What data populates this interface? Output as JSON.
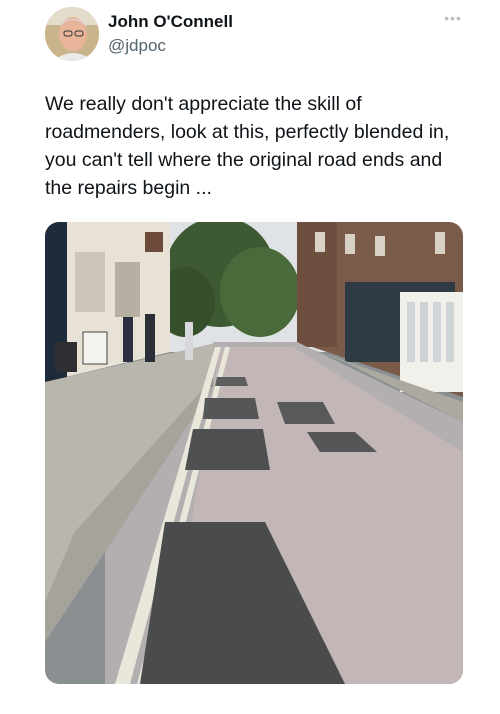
{
  "author": {
    "display_name": "John O'Connell",
    "handle": "@jdpoc"
  },
  "post": {
    "text": "We really don't appreciate the skill of roadmenders, look at this, perfectly blended in, you can't tell where the original road ends and the repairs begin ...",
    "more_icon": "more-horizontal-icon"
  },
  "media": {
    "kind": "photo",
    "subject": "street-photo"
  },
  "colors": {
    "text_primary": "#0f1419",
    "text_secondary": "#536471",
    "background": "#ffffff"
  }
}
